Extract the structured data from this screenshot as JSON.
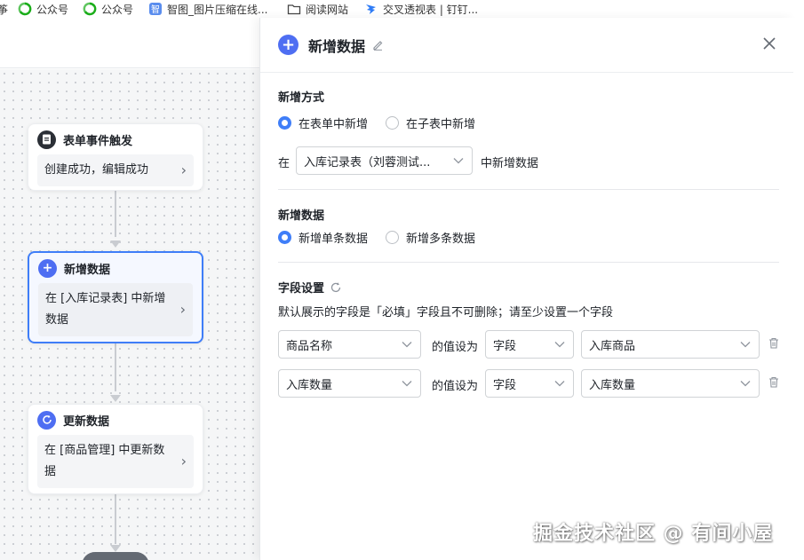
{
  "bookmarks": [
    {
      "label": "公众号",
      "icon": "wechat-mp-icon"
    },
    {
      "label": "公众号",
      "icon": "wechat-mp-icon"
    },
    {
      "label": "智图_图片压缩在线...",
      "icon": "zhitu-icon"
    },
    {
      "label": "阅读网站",
      "icon": "folder-icon"
    },
    {
      "label": "交叉透视表 | 钉钉...",
      "icon": "dingtalk-icon"
    }
  ],
  "flow": {
    "nodes": [
      {
        "title": "表单事件触发",
        "body": "创建成功，编辑成功",
        "icon": "document-icon",
        "icon_color": "#2b2f36"
      },
      {
        "title": "新增数据",
        "body": "在 [入库记录表] 中新增数据",
        "icon": "plus-icon",
        "icon_color": "#4e6ef2"
      },
      {
        "title": "更新数据",
        "body": "在 [商品管理] 中更新数据",
        "icon": "refresh-icon",
        "icon_color": "#4e6ef2"
      }
    ]
  },
  "panel": {
    "title": "新增数据",
    "add_mode": {
      "title": "新增方式",
      "options": [
        "在表单中新增",
        "在子表中新增"
      ],
      "selected": 0,
      "prefix": "在",
      "table_select": "入库记录表（刘蓉测试...",
      "suffix": "中新增数据"
    },
    "add_data": {
      "title": "新增数据",
      "options": [
        "新增单条数据",
        "新增多条数据"
      ],
      "selected": 0
    },
    "field_settings": {
      "title": "字段设置",
      "description": "默认展示的字段是「必填」字段且不可删除；请至少设置一个字段",
      "value_label": "的值设为",
      "rows": [
        {
          "field": "商品名称",
          "type": "字段",
          "value": "入库商品"
        },
        {
          "field": "入库数量",
          "type": "字段",
          "value": "入库数量"
        }
      ]
    }
  },
  "watermark": "掘金技术社区 @ 有间小屋",
  "colors": {
    "accent": "#3f7ef8",
    "node_icon_blue": "#4e6ef2"
  }
}
